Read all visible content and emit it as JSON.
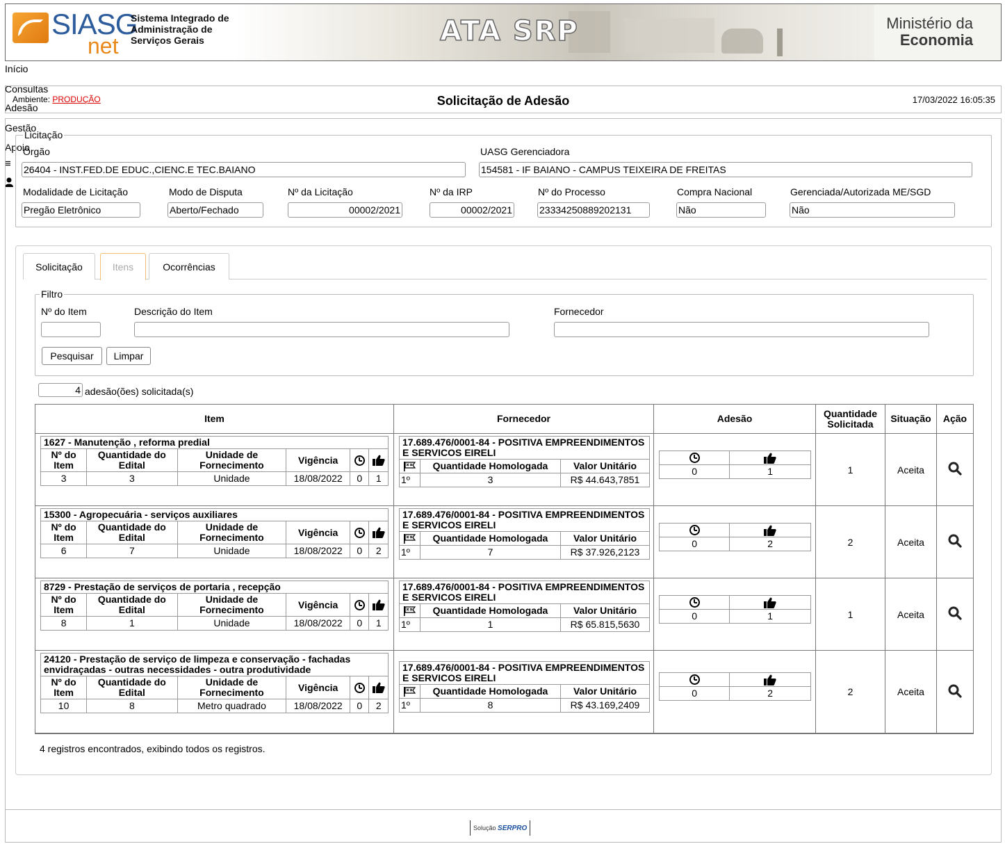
{
  "header": {
    "logo_siasg": "SIASG",
    "logo_net": "net",
    "system_desc": [
      "Sistema Integrado de",
      "Administração de",
      "Serviços Gerais"
    ],
    "banner_title": "ATA SRP",
    "ministry_line1": "Ministério da",
    "ministry_line2": "Economia"
  },
  "menu": {
    "items": [
      "Início",
      "Consultas",
      "Adesão",
      "Gestão",
      "Apoio"
    ],
    "icons": [
      "hamburger-icon",
      "user-icon"
    ]
  },
  "titlebar": {
    "env_label": "Ambiente:",
    "env_value": "PRODUÇÃO",
    "title": "Solicitação de Adesão",
    "datetime": "17/03/2022 16:05:35"
  },
  "licitacao": {
    "legend": "Licitação",
    "orgao_label": "Órgão",
    "orgao_value": "26404 - INST.FED.DE EDUC.,CIENC.E TEC.BAIANO",
    "uasg_label": "UASG Gerenciadora",
    "uasg_value": "154581 - IF BAIANO - CAMPUS TEIXEIRA DE FREITAS",
    "modalidade_label": "Modalidade de Licitação",
    "modalidade_value": "Pregão Eletrônico",
    "modo_label": "Modo de Disputa",
    "modo_value": "Aberto/Fechado",
    "num_licitacao_label": "Nº da Licitação",
    "num_licitacao_value": "00002/2021",
    "irp_label": "Nº da IRP",
    "irp_value": "00002/2021",
    "processo_label": "Nº do Processo",
    "processo_value": "23334250889202131",
    "compra_label": "Compra Nacional",
    "compra_value": "Não",
    "gerenciada_label": "Gerenciada/Autorizada ME/SGD",
    "gerenciada_value": "Não"
  },
  "tabs": [
    "Solicitação",
    "Itens",
    "Ocorrências"
  ],
  "active_tab": "Itens",
  "filtro": {
    "legend": "Filtro",
    "num_item_label": "Nº do Item",
    "descricao_label": "Descrição do Item",
    "fornecedor_label": "Fornecedor",
    "search_button": "Pesquisar",
    "clear_button": "Limpar"
  },
  "count": {
    "value": "4",
    "label": "adesão(ões) solicitada(s)"
  },
  "grid": {
    "headers": {
      "item": "Item",
      "fornecedor": "Fornecedor",
      "adesao": "Adesão",
      "quantidade": "Quantidade Solicitada",
      "situacao": "Situação",
      "acao": "Ação"
    },
    "item_cols": {
      "num": "Nº do Item",
      "qtd_edital": "Quantidade do Edital",
      "unidade": "Unidade de Fornecimento",
      "vigencia": "Vigência"
    },
    "forn_cols": {
      "qtd_homologada": "Quantidade Homologada",
      "valor_unitario": "Valor Unitário"
    },
    "rows": [
      {
        "item_title": "1627 - Manutenção , reforma predial",
        "num": "3",
        "qtd_edital": "3",
        "unidade": "Unidade",
        "vigencia": "18/08/2022",
        "pending": "0",
        "approved": "1",
        "fornecedor": "17.689.476/0001-84 - POSITIVA EMPREENDIMENTOS E SERVICOS EIRELI",
        "rank": "1º",
        "qtd_homologada": "3",
        "valor": "R$ 44.643,7851",
        "ad_pending": "0",
        "ad_approved": "1",
        "quantidade": "1",
        "situacao": "Aceita"
      },
      {
        "item_title": "15300 - Agropecuária - serviços auxiliares",
        "num": "6",
        "qtd_edital": "7",
        "unidade": "Unidade",
        "vigencia": "18/08/2022",
        "pending": "0",
        "approved": "2",
        "fornecedor": "17.689.476/0001-84 - POSITIVA EMPREENDIMENTOS E SERVICOS EIRELI",
        "rank": "1º",
        "qtd_homologada": "7",
        "valor": "R$ 37.926,2123",
        "ad_pending": "0",
        "ad_approved": "2",
        "quantidade": "2",
        "situacao": "Aceita"
      },
      {
        "item_title": "8729 - Prestação de serviços de portaria , recepção",
        "num": "8",
        "qtd_edital": "1",
        "unidade": "Unidade",
        "vigencia": "18/08/2022",
        "pending": "0",
        "approved": "1",
        "fornecedor": "17.689.476/0001-84 - POSITIVA EMPREENDIMENTOS E SERVICOS EIRELI",
        "rank": "1º",
        "qtd_homologada": "1",
        "valor": "R$ 65.815,5630",
        "ad_pending": "0",
        "ad_approved": "1",
        "quantidade": "1",
        "situacao": "Aceita"
      },
      {
        "item_title": "24120 - Prestação de serviço de limpeza e conservação - fachadas envidraçadas - outras necessidades - outra produtividade",
        "num": "10",
        "qtd_edital": "8",
        "unidade": "Metro quadrado",
        "vigencia": "18/08/2022",
        "pending": "0",
        "approved": "2",
        "fornecedor": "17.689.476/0001-84 - POSITIVA EMPREENDIMENTOS E SERVICOS EIRELI",
        "rank": "1º",
        "qtd_homologada": "8",
        "valor": "R$ 43.169,2409",
        "ad_pending": "0",
        "ad_approved": "2",
        "quantidade": "2",
        "situacao": "Aceita"
      }
    ]
  },
  "records_text": "4 registros encontrados, exibindo todos os registros.",
  "footer": {
    "solucao": "Solução",
    "serpro": "SERPRO"
  }
}
